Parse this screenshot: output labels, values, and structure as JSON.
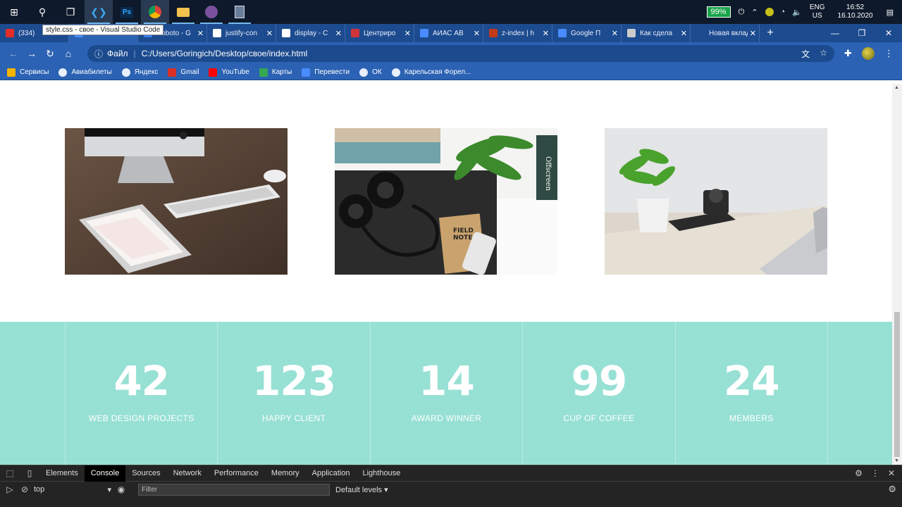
{
  "taskbar": {
    "battery": "99%",
    "lang_top": "ENG",
    "lang_bottom": "US",
    "time": "16:52",
    "date": "16.10.2020"
  },
  "tooltip": "style.css - свое - Visual Studio Code",
  "tabs": [
    {
      "label": "(334)",
      "color": "#e52d27"
    },
    {
      "label": "",
      "color": "#4a8cff"
    },
    {
      "label": "Roboto - G",
      "color": "#3c7ef0"
    },
    {
      "label": "justify-con",
      "color": "#ffffff"
    },
    {
      "label": "display - C",
      "color": "#ffffff"
    },
    {
      "label": "Центриро",
      "color": "#d13438"
    },
    {
      "label": "АИАС АВ",
      "color": "#4a8cff"
    },
    {
      "label": "z-index | h",
      "color": "#c13b19"
    },
    {
      "label": "Google П",
      "color": "#4a8cff"
    },
    {
      "label": "Как сдела",
      "color": "#cccccc"
    },
    {
      "label": "Новая вкладк",
      "color": "#1d4b8f"
    }
  ],
  "address": {
    "scheme": "Файл",
    "url": "C:/Users/Goringich/Desktop/свое/index.html"
  },
  "bookmarks": [
    {
      "label": "Сервисы"
    },
    {
      "label": "Авиабилеты"
    },
    {
      "label": "Яндекс"
    },
    {
      "label": "Gmail"
    },
    {
      "label": "YouTube"
    },
    {
      "label": "Карты"
    },
    {
      "label": "Перевести"
    },
    {
      "label": "ОК"
    },
    {
      "label": "Карельская Форел..."
    }
  ],
  "stats": [
    {
      "number": "42",
      "label": "WEB DESIGN PROJECTS"
    },
    {
      "number": "123",
      "label": "HAPPY CLIENT"
    },
    {
      "number": "14",
      "label": "AWARD WINNER"
    },
    {
      "number": "99",
      "label": "CUP OF COFFEE"
    },
    {
      "number": "24",
      "label": "MEMBERS"
    }
  ],
  "devtools": {
    "tabs": [
      "Elements",
      "Console",
      "Sources",
      "Network",
      "Performance",
      "Memory",
      "Application",
      "Lighthouse"
    ],
    "context": "top",
    "filter_placeholder": "Filter",
    "levels": "Default levels"
  },
  "colors": {
    "stats_bg": "#97e0d4",
    "chrome_blue": "#2b62b3"
  }
}
